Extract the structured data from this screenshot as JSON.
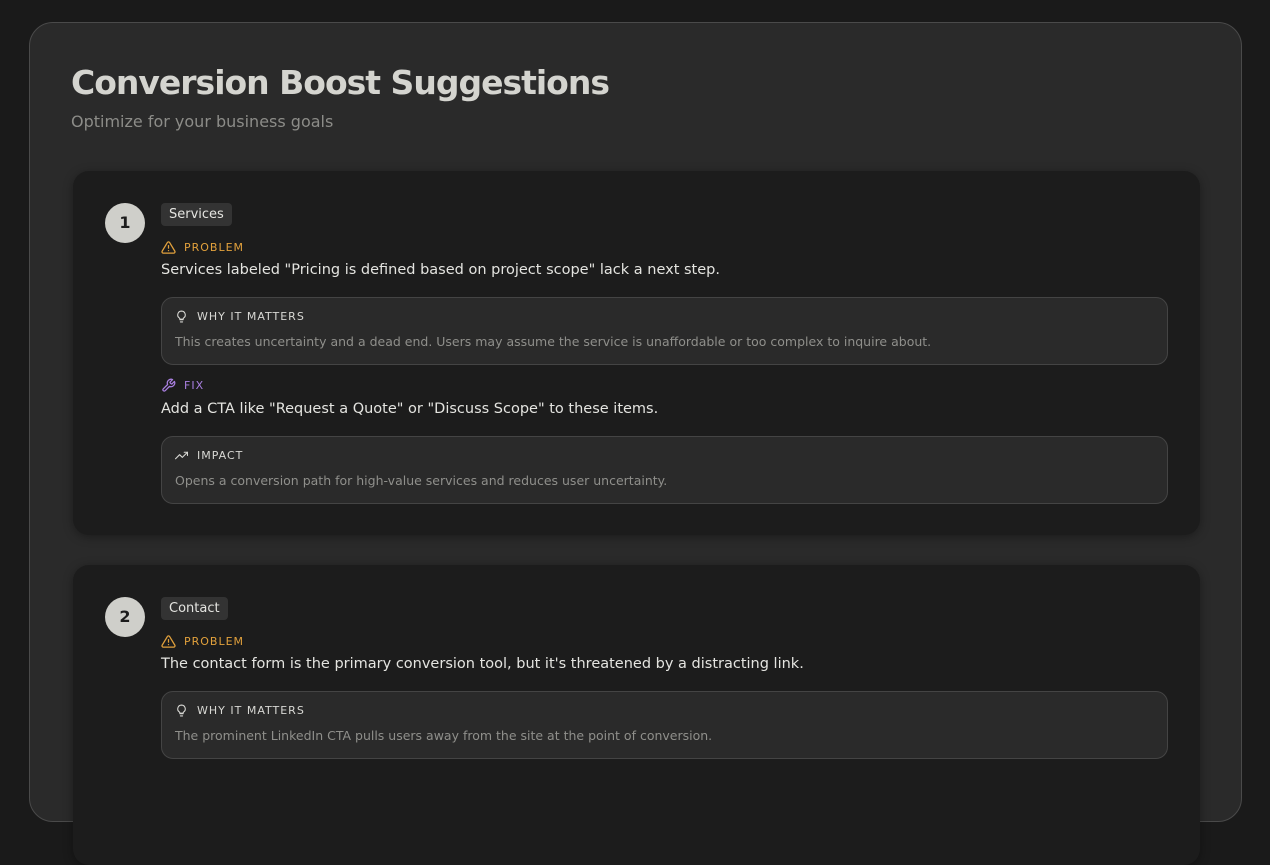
{
  "header": {
    "title": "Conversion Boost Suggestions",
    "subtitle": "Optimize for your business goals"
  },
  "colors": {
    "problem": "#e2a13c",
    "fix": "#a97fe0",
    "number_badge": "#cfcfca"
  },
  "suggestions": [
    {
      "number": "1",
      "category": "Services",
      "problem_label": "PROBLEM",
      "problem": "Services labeled \"Pricing is defined based on project scope\" lack a next step.",
      "why_label": "WHY IT MATTERS",
      "why": "This creates uncertainty and a dead end. Users may assume the service is unaffordable or too complex to inquire about.",
      "fix_label": "FIX",
      "fix": "Add a CTA like \"Request a Quote\" or \"Discuss Scope\" to these items.",
      "impact_label": "IMPACT",
      "impact": "Opens a conversion path for high-value services and reduces user uncertainty."
    },
    {
      "number": "2",
      "category": "Contact",
      "problem_label": "PROBLEM",
      "problem": "The contact form is the primary conversion tool, but it's threatened by a distracting link.",
      "why_label": "WHY IT MATTERS",
      "why": "The prominent LinkedIn CTA pulls users away from the site at the point of conversion."
    }
  ],
  "icons": {
    "problem": "warning-triangle-icon",
    "why": "lightbulb-icon",
    "fix": "wrench-icon",
    "impact": "trending-up-icon"
  }
}
